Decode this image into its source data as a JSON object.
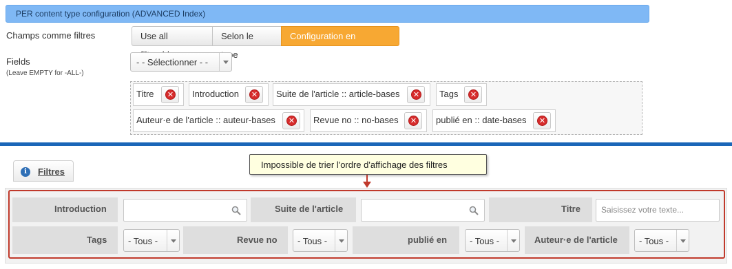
{
  "config": {
    "header": "PER content type configuration (ADVANCED Index)",
    "champs_label": "Champs comme filtres",
    "options": [
      "Use all filterable",
      "Selon le type",
      "Configuration en dessous"
    ],
    "active_option": "Configuration en dessous",
    "fields_label": "Fields",
    "fields_hint": "(Leave EMPTY for -ALL-)",
    "fields_select": "- - Sélectionner - -",
    "chips": [
      "Titre",
      "Introduction",
      "Suite de l'article :: article-bases",
      "Tags",
      "Auteur·e de l'article :: auteur-bases",
      "Revue no :: no-bases",
      "publié en :: date-bases"
    ],
    "remove_glyph": "✕"
  },
  "filtres": {
    "tab_label": "Filtres",
    "info_glyph": "i",
    "tooltip": "Impossible de trier l'ordre d'affichage des filtres",
    "row1": {
      "introduction_label": "Introduction",
      "suite_label": "Suite de l'article",
      "titre_label": "Titre",
      "titre_placeholder": "Saisissez votre texte..."
    },
    "row2": {
      "tags_label": "Tags",
      "tags_value": "- Tous -",
      "revue_label": "Revue no",
      "revue_value": "- Tous -",
      "publie_label": "publié en",
      "publie_value": "- Tous -",
      "auteur_label": "Auteur·e de l'article",
      "auteur_value": "- Tous -"
    }
  },
  "colors": {
    "header_bg": "#7fb8f5",
    "active_button": "#f7a833",
    "divider": "#1a66b8",
    "annotation_red": "#c0392b",
    "tooltip_bg": "#ffffe0",
    "remove_icon": "#d72c2c"
  },
  "icons": [
    "remove-icon",
    "info-icon",
    "search-icon",
    "dropdown-arrow-icon",
    "red-arrow-icon"
  ]
}
